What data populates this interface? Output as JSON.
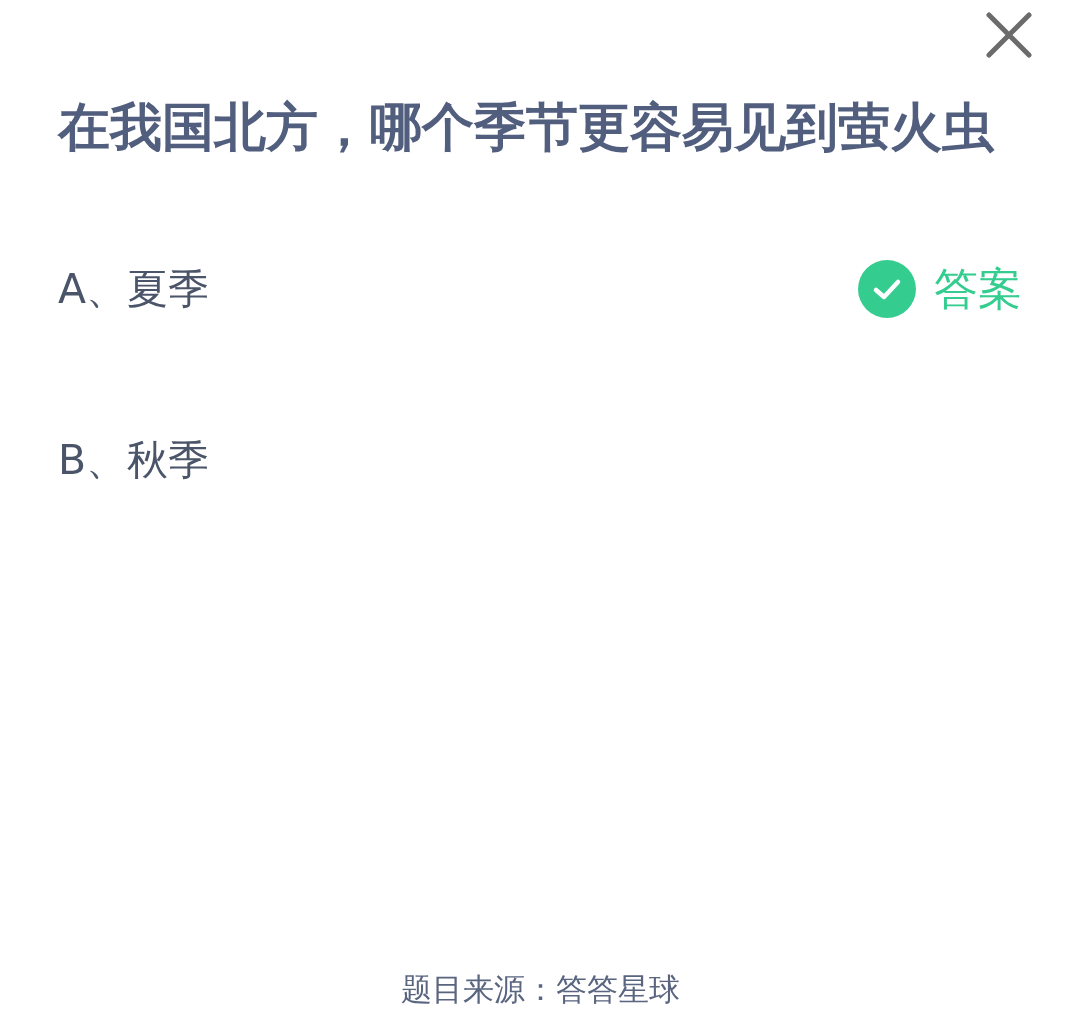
{
  "question": {
    "title": "在我国北方，哪个季节更容易见到萤火虫",
    "answer_label": "答案",
    "options": [
      {
        "label": "A、夏季",
        "correct": true
      },
      {
        "label": "B、秋季",
        "correct": false
      }
    ]
  },
  "source": "题目来源：答答星球"
}
